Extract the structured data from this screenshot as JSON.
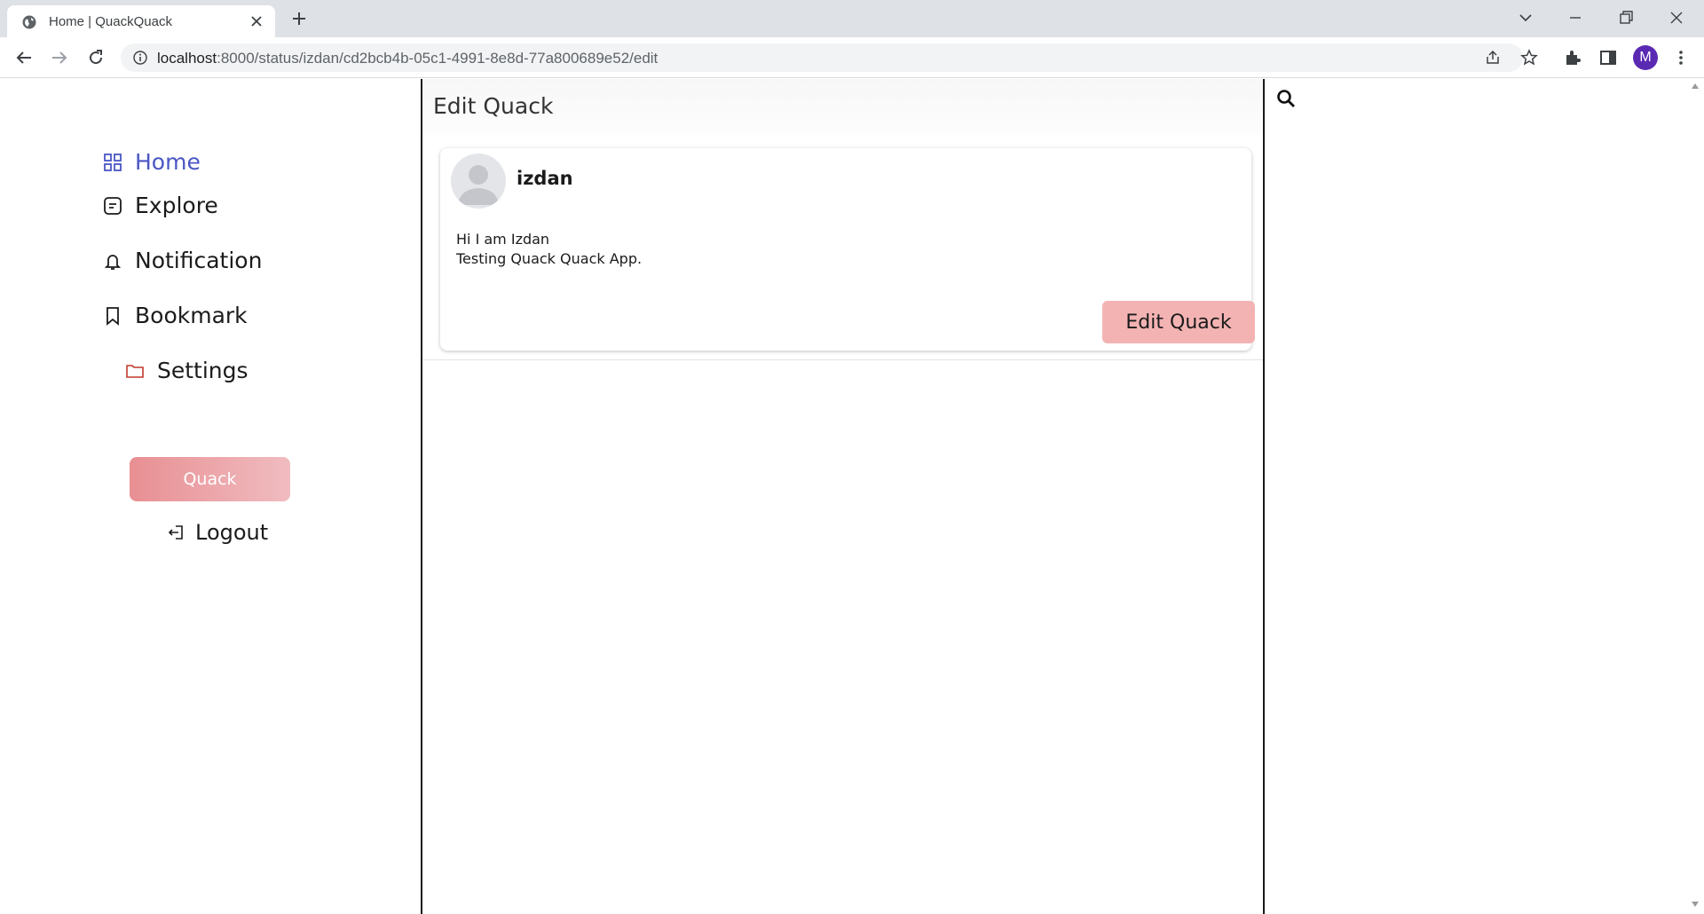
{
  "browser": {
    "tab_title": "Home | QuackQuack",
    "url_host": "localhost",
    "url_rest": ":8000/status/izdan/cd2bcb4b-05c1-4991-8e8d-77a800689e52/edit",
    "profile_initial": "M"
  },
  "sidebar": {
    "items": [
      {
        "label": "Home",
        "icon": "grid-icon",
        "active": true
      },
      {
        "label": "Explore",
        "icon": "note-icon",
        "active": false
      },
      {
        "label": "Notification",
        "icon": "bell-icon",
        "active": false
      },
      {
        "label": "Bookmark",
        "icon": "bookmark-icon",
        "active": false
      },
      {
        "label": "Settings",
        "icon": "folder-icon",
        "active": false
      }
    ],
    "quack_button": "Quack",
    "logout": "Logout"
  },
  "main": {
    "title": "Edit Quack",
    "post": {
      "username": "izdan",
      "lines": [
        "Hi I am Izdan",
        "Testing Quack Quack App."
      ],
      "edit_button": "Edit Quack"
    }
  },
  "colors": {
    "active_nav": "#4a56c4",
    "quack_gradient_start": "#e88f93",
    "quack_gradient_end": "#f0bcc0",
    "edit_button": "#f4b3b3",
    "settings_icon": "#c0392b"
  }
}
